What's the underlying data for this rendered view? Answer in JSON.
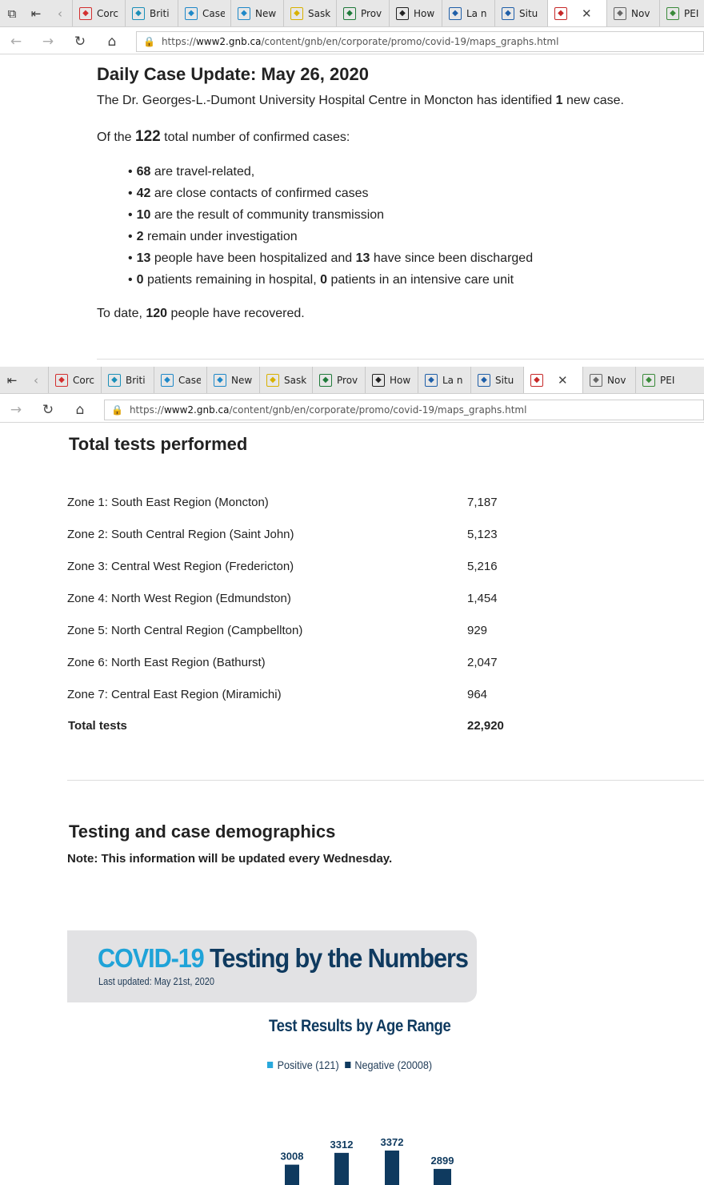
{
  "browser": {
    "tabs_top": [
      {
        "label": "Corc",
        "icon": "canada-flag-icon",
        "color": "#d32f2f"
      },
      {
        "label": "Briti",
        "icon": "bc-logo-icon",
        "color": "#1b8fb8"
      },
      {
        "label": "Case",
        "icon": "alberta-icon",
        "color": "#1e88c8"
      },
      {
        "label": "New",
        "icon": "alberta-icon",
        "color": "#1e88c8"
      },
      {
        "label": "Sask",
        "icon": "saskatchewan-icon",
        "color": "#d8b100"
      },
      {
        "label": "Prov",
        "icon": "manitoba-icon",
        "color": "#1f7a3a"
      },
      {
        "label": "How",
        "icon": "ontario-icon",
        "color": "#222222"
      },
      {
        "label": "La n",
        "icon": "quebec-fleur-icon",
        "color": "#1f5fa8"
      },
      {
        "label": "Situ",
        "icon": "quebec-fleur-icon",
        "color": "#1f5fa8"
      },
      {
        "label": "",
        "icon": "nb-logo-icon",
        "color": "#c62828",
        "active": true
      },
      {
        "label": "Nov",
        "icon": "nova-scotia-icon",
        "color": "#666666"
      },
      {
        "label": "PEI",
        "icon": "pei-tree-icon",
        "color": "#3a8a3a"
      }
    ],
    "tabs_bottom": [
      {
        "label": "Corc",
        "icon": "canada-flag-icon",
        "color": "#d32f2f"
      },
      {
        "label": "Briti",
        "icon": "bc-logo-icon",
        "color": "#1b8fb8"
      },
      {
        "label": "Case",
        "icon": "alberta-icon",
        "color": "#1e88c8"
      },
      {
        "label": "New",
        "icon": "alberta-icon",
        "color": "#1e88c8"
      },
      {
        "label": "Sask",
        "icon": "saskatchewan-icon",
        "color": "#d8b100"
      },
      {
        "label": "Prov",
        "icon": "manitoba-icon",
        "color": "#1f7a3a"
      },
      {
        "label": "How",
        "icon": "ontario-icon",
        "color": "#222222"
      },
      {
        "label": "La n",
        "icon": "quebec-fleur-icon",
        "color": "#1f5fa8"
      },
      {
        "label": "Situ",
        "icon": "quebec-fleur-icon",
        "color": "#1f5fa8"
      },
      {
        "label": "",
        "icon": "nb-logo-icon",
        "color": "#c62828",
        "active": true
      },
      {
        "label": "Nov",
        "icon": "nova-scotia-icon",
        "color": "#666666"
      },
      {
        "label": "PEI",
        "icon": "pei-tree-icon",
        "color": "#3a8a3a"
      }
    ],
    "url_prefix": "https://",
    "url_host": "www2.gnb.ca",
    "url_path": "/content/gnb/en/corporate/promo/covid-19/maps_graphs.html"
  },
  "update": {
    "title": "Daily Case Update: May 26, 2020",
    "intro_prefix": "The Dr. Georges-L.-Dumont University Hospital Centre in Moncton has identified ",
    "intro_count": "1",
    "intro_suffix": " new case.",
    "total_prefix": "Of the ",
    "total_count": "122",
    "total_suffix": " total number of confirmed cases:",
    "bullets": [
      {
        "n1": "68",
        "t1": " are travel-related,",
        "n2": "",
        "t2": ""
      },
      {
        "n1": "42",
        "t1": " are close contacts of confirmed cases",
        "n2": "",
        "t2": ""
      },
      {
        "n1": "10",
        "t1": " are the result of community transmission",
        "n2": "",
        "t2": ""
      },
      {
        "n1": "2",
        "t1": " remain under investigation",
        "n2": "",
        "t2": ""
      },
      {
        "n1": "13",
        "t1": " people have been hospitalized and ",
        "n2": "13",
        "t2": " have since been discharged"
      },
      {
        "n1": "0",
        "t1": " patients remaining in hospital, ",
        "n2": "0",
        "t2": " patients in an intensive care unit"
      }
    ],
    "recovered_prefix": "To date, ",
    "recovered_count": "120",
    "recovered_suffix": " people have recovered."
  },
  "tests": {
    "heading": "Total tests performed",
    "rows": [
      {
        "zone": "Zone 1: South East Region (Moncton)",
        "value": "7,187"
      },
      {
        "zone": "Zone 2: South Central Region (Saint John)",
        "value": "5,123"
      },
      {
        "zone": "Zone 3: Central West Region (Fredericton)",
        "value": "5,216"
      },
      {
        "zone": "Zone 4: North West Region (Edmundston)",
        "value": "1,454"
      },
      {
        "zone": "Zone 5: North Central Region (Campbellton)",
        "value": "929"
      },
      {
        "zone": "Zone 6: North East Region (Bathurst)",
        "value": "2,047"
      },
      {
        "zone": "Zone 7: Central East Region (Miramichi)",
        "value": "964"
      }
    ],
    "total_label": "Total tests",
    "total_value": "22,920"
  },
  "demographics": {
    "heading": "Testing and case demographics",
    "note": "Note: This information will be updated every Wednesday."
  },
  "infographic": {
    "title_part1": "COVID-19",
    "title_part2": " Testing by the Numbers",
    "last_updated": "Last updated: May 21st, 2020",
    "colors": {
      "positive": "#29a8dc",
      "negative": "#0f3a5f",
      "banner_bg": "#e2e2e4"
    }
  },
  "chart_data": {
    "type": "bar",
    "title": "Test Results by Age Range",
    "legend": [
      {
        "name": "Positive (121)",
        "color": "#29a8dc"
      },
      {
        "name": "Negative (20008)",
        "color": "#0f3a5f"
      }
    ],
    "series": [
      {
        "name": "Negative (20008)",
        "values": [
          3008,
          3312,
          3372,
          2899
        ]
      }
    ],
    "data_labels": [
      "3008",
      "3312",
      "3372",
      "2899"
    ],
    "note": "chart cropped at bottom edge of screenshot"
  }
}
